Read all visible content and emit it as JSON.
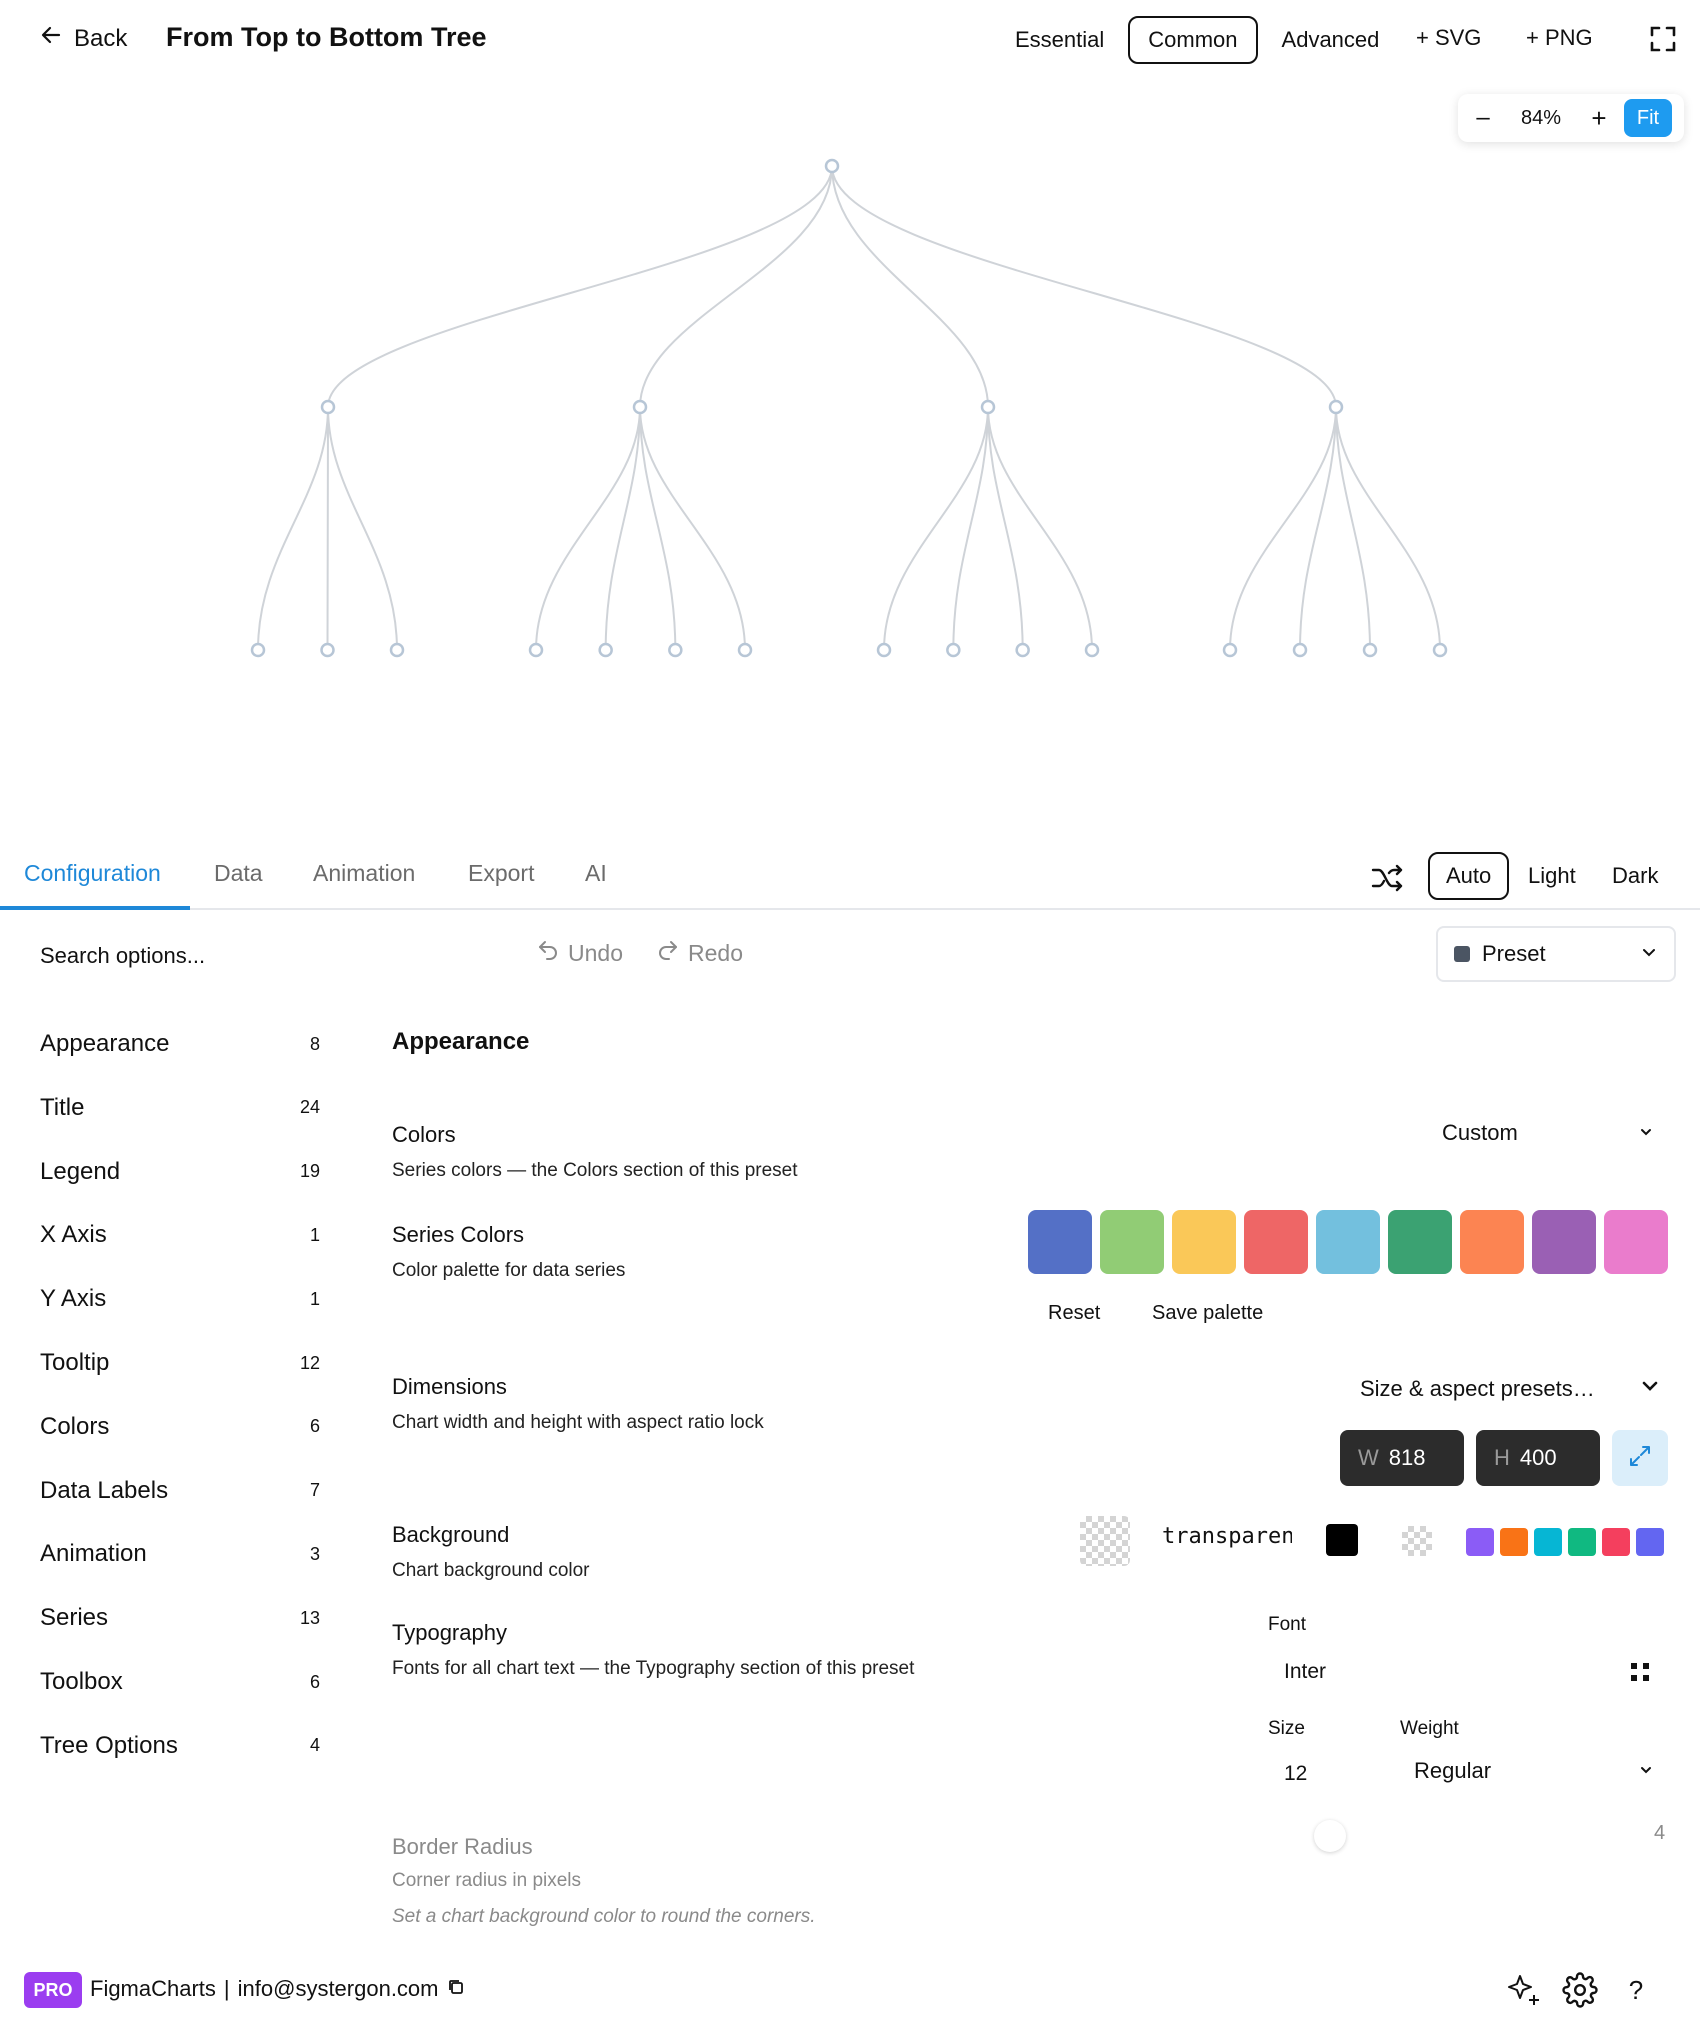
{
  "header": {
    "back_label": "Back",
    "title": "From Top to Bottom Tree",
    "modes": [
      "Essential",
      "Common",
      "Advanced"
    ],
    "active_mode": "Common",
    "add_svg": "+ SVG",
    "add_png": "+ PNG"
  },
  "zoom": {
    "minus": "–",
    "value": "84%",
    "plus": "+",
    "fit": "Fit"
  },
  "chart_data": {
    "type": "tree",
    "orientation": "top-to-bottom",
    "root_children": [
      3,
      4,
      4,
      4
    ],
    "node_color": "#b7c6d6",
    "link_color": "#cfd3d8"
  },
  "tabs": {
    "items": [
      "Configuration",
      "Data",
      "Animation",
      "Export",
      "AI"
    ],
    "active": "Configuration",
    "themes": [
      "Auto",
      "Light",
      "Dark"
    ],
    "active_theme": "Auto"
  },
  "toolbar": {
    "search_placeholder": "Search options...",
    "undo": "Undo",
    "redo": "Redo",
    "preset": "Preset"
  },
  "sidebar": {
    "items": [
      {
        "label": "Appearance",
        "count": "8"
      },
      {
        "label": "Title",
        "count": "24"
      },
      {
        "label": "Legend",
        "count": "19"
      },
      {
        "label": "X Axis",
        "count": "1"
      },
      {
        "label": "Y Axis",
        "count": "1"
      },
      {
        "label": "Tooltip",
        "count": "12"
      },
      {
        "label": "Colors",
        "count": "6"
      },
      {
        "label": "Data Labels",
        "count": "7"
      },
      {
        "label": "Animation",
        "count": "3"
      },
      {
        "label": "Series",
        "count": "13"
      },
      {
        "label": "Toolbox",
        "count": "6"
      },
      {
        "label": "Tree Options",
        "count": "4"
      }
    ]
  },
  "panel": {
    "section_title": "Appearance",
    "colors": {
      "title": "Colors",
      "desc": "Series colors — the Colors section of this preset",
      "value": "Custom"
    },
    "series_colors": {
      "title": "Series Colors",
      "desc": "Color palette for data series",
      "palette": [
        "#5470c6",
        "#91cc75",
        "#fac858",
        "#ee6666",
        "#73c0de",
        "#3ba272",
        "#fc8452",
        "#9a60b4",
        "#ea7ccc"
      ],
      "reset": "Reset",
      "save": "Save palette"
    },
    "dimensions": {
      "title": "Dimensions",
      "desc": "Chart width and height with aspect ratio lock",
      "presets": "Size & aspect presets…",
      "w_label": "W",
      "w_value": "818",
      "h_label": "H",
      "h_value": "400"
    },
    "background": {
      "title": "Background",
      "desc": "Chart background color",
      "value": "transparent",
      "quick_colors": [
        "#8b5cf6",
        "#f97316",
        "#06b6d4",
        "#10b981",
        "#f43f5e",
        "#6366f1"
      ]
    },
    "typography": {
      "title": "Typography",
      "desc": "Fonts for all chart text — the Typography section of this preset",
      "font_label": "Font",
      "font_value": "Inter",
      "size_label": "Size",
      "size_value": "12",
      "weight_label": "Weight",
      "weight_value": "Regular"
    },
    "border_radius": {
      "title": "Border Radius",
      "desc": "Corner radius in pixels",
      "note": "Set a chart background color to round the corners.",
      "value": "4"
    }
  },
  "footer": {
    "badge": "PRO",
    "brand": "FigmaCharts",
    "separator": "|",
    "email": "info@systergon.com"
  }
}
